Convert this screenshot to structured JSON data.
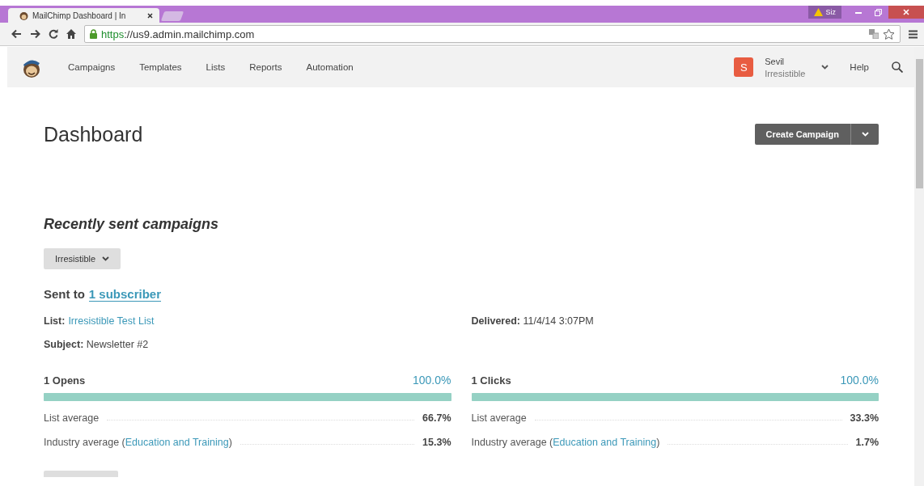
{
  "browser": {
    "tab": {
      "title": "MailChimp Dashboard | In"
    },
    "url": {
      "scheme": "https",
      "rest": "://us9.admin.mailchimp.com"
    },
    "profile_badge": "Siz"
  },
  "nav": {
    "items": [
      "Campaigns",
      "Templates",
      "Lists",
      "Reports",
      "Automation"
    ],
    "user": {
      "initial": "S",
      "name": "Sevil",
      "org": "Irresistible"
    },
    "help": "Help"
  },
  "page": {
    "title": "Dashboard",
    "create_button": "Create Campaign"
  },
  "recent": {
    "heading": "Recently sent campaigns",
    "list_filter": "Irresistible",
    "sent_to_label": "Sent to",
    "sent_to_link": "1 subscriber",
    "list_label": "List:",
    "list_link": "Irresistible Test List",
    "delivered": "**Delivered:** 11/4/14 3:07PM",
    "subject": "**Subject:** Newsletter #2",
    "stats": [
      {
        "label": "1 Opens",
        "percent": "100.0%",
        "level": 1,
        "list_average_label": "List average",
        "list_average": "66.7%",
        "industry_prefix": "Industry average (",
        "industry_link": "Education and Training",
        "industry_suffix": ")",
        "industry_average": "15.3%"
      },
      {
        "label": "1 Clicks",
        "percent": "100.0%",
        "level": 1,
        "list_average_label": "List average",
        "list_average": "33.3%",
        "industry_prefix": "Industry average (",
        "industry_link": "Education and Training",
        "industry_suffix": ")",
        "industry_average": "1.7%"
      }
    ]
  }
}
